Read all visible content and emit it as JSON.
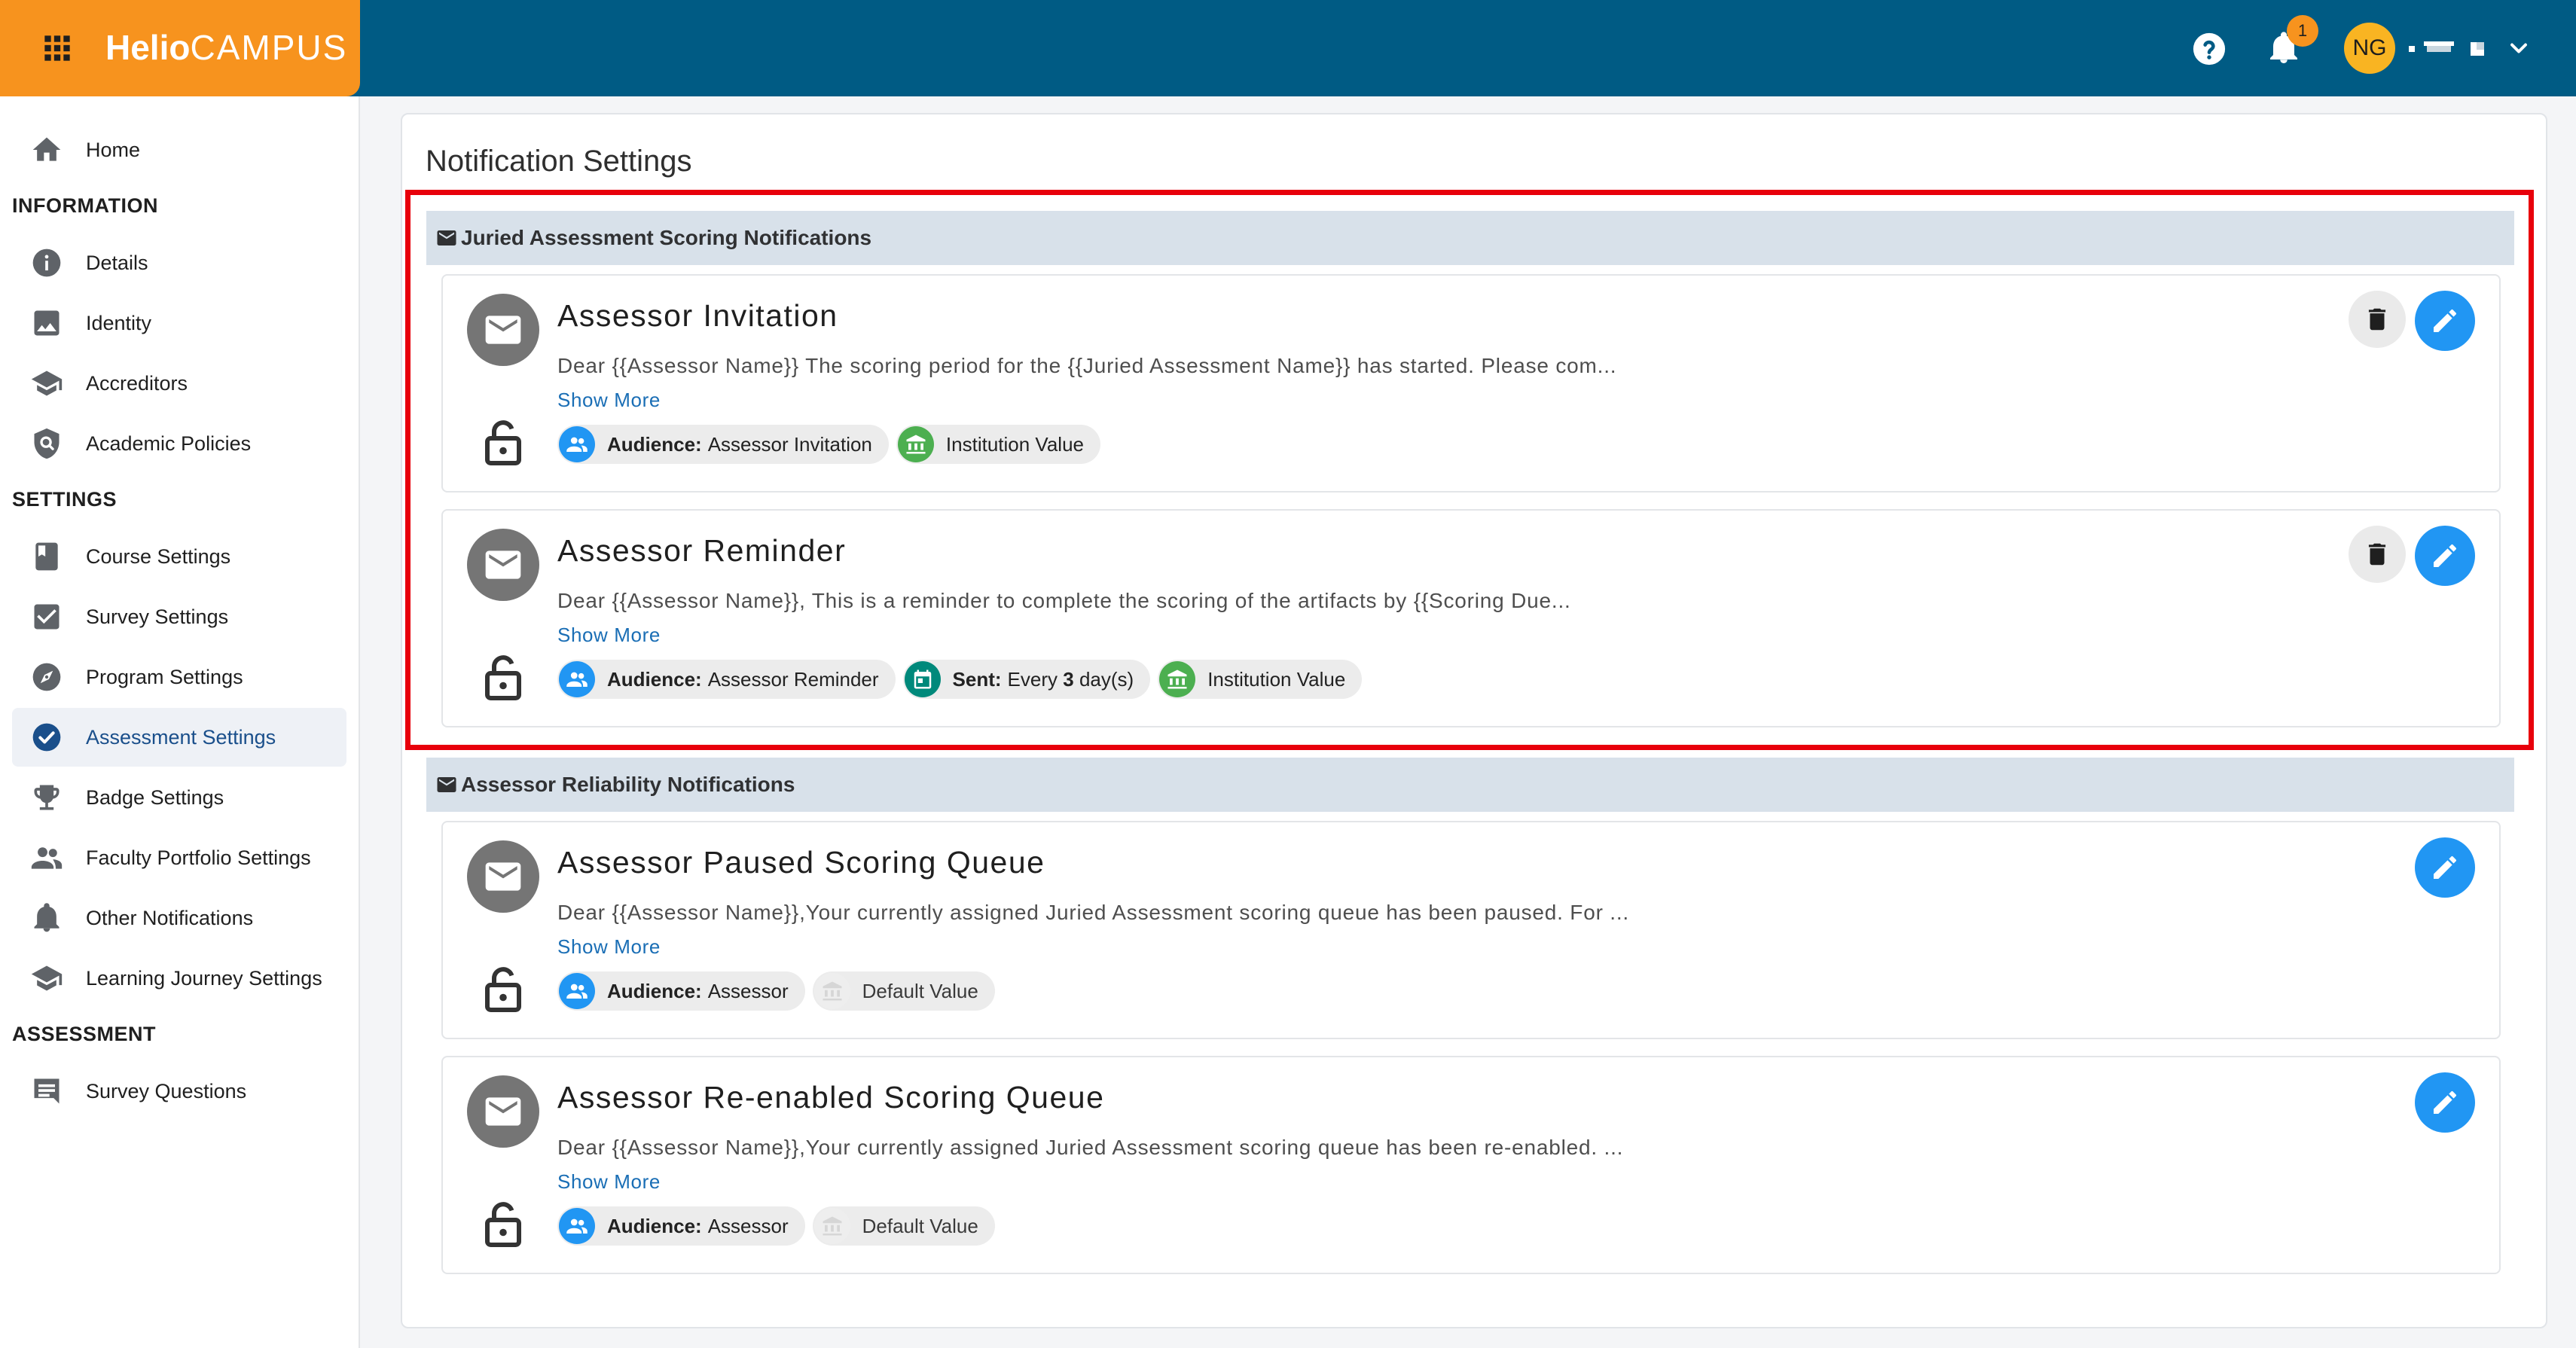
{
  "header": {
    "brand_part1": "Helio",
    "brand_part2": "CAMPUS",
    "notification_count": "1",
    "user_initials": "NG"
  },
  "sidebar": {
    "items": [
      {
        "label": "Home",
        "icon": "home-icon"
      },
      {
        "heading": "INFORMATION"
      },
      {
        "label": "Details",
        "icon": "info-icon"
      },
      {
        "label": "Identity",
        "icon": "image-icon"
      },
      {
        "label": "Accreditors",
        "icon": "school-icon"
      },
      {
        "label": "Academic Policies",
        "icon": "policy-icon"
      },
      {
        "heading": "SETTINGS"
      },
      {
        "label": "Course Settings",
        "icon": "book-icon"
      },
      {
        "label": "Survey Settings",
        "icon": "checkbox-icon"
      },
      {
        "label": "Program Settings",
        "icon": "compass-icon"
      },
      {
        "label": "Assessment Settings",
        "icon": "check-circle-icon",
        "active": true
      },
      {
        "label": "Badge Settings",
        "icon": "trophy-icon"
      },
      {
        "label": "Faculty Portfolio Settings",
        "icon": "people-icon"
      },
      {
        "label": "Other Notifications",
        "icon": "bell-icon"
      },
      {
        "label": "Learning Journey Settings",
        "icon": "school-icon"
      },
      {
        "heading": "ASSESSMENT"
      },
      {
        "label": "Survey Questions",
        "icon": "comment-icon"
      }
    ]
  },
  "main": {
    "title": "Notification Settings",
    "groups": [
      {
        "title": "Juried Assessment Scoring Notifications",
        "cards": [
          {
            "title": "Assessor Invitation",
            "text": "Dear {{Assessor Name}} The scoring period for the {{Juried Assessment Name}} has started. Please com...",
            "show_more": "Show More",
            "audience_label": "Audience:",
            "audience": "Assessor Invitation",
            "value_label": "Institution Value",
            "deletable": true
          },
          {
            "title": "Assessor Reminder",
            "text": "Dear {{Assessor Name}}, This is a reminder to complete the scoring of the artifacts by {{Scoring Due...",
            "show_more": "Show More",
            "audience_label": "Audience:",
            "audience": "Assessor Reminder",
            "sent_label": "Sent:",
            "sent_pre": "Every",
            "sent_num": "3",
            "sent_post": "day(s)",
            "value_label": "Institution Value",
            "deletable": true
          }
        ]
      },
      {
        "title": "Assessor Reliability Notifications",
        "cards": [
          {
            "title": "Assessor Paused Scoring Queue",
            "text": "Dear {{Assessor Name}},Your currently assigned Juried Assessment scoring queue has been paused. For ...",
            "show_more": "Show More",
            "audience_label": "Audience:",
            "audience": "Assessor",
            "value_label": "Default Value",
            "deletable": false
          },
          {
            "title": "Assessor Re-enabled Scoring Queue",
            "text": "Dear {{Assessor Name}},Your currently assigned Juried Assessment scoring queue has been re-enabled. ...",
            "show_more": "Show More",
            "audience_label": "Audience:",
            "audience": "Assessor",
            "value_label": "Default Value",
            "deletable": false
          }
        ]
      }
    ]
  },
  "colors": {
    "topbar": "#005b84",
    "brand": "#f7931e",
    "primary_blue": "#2196f3",
    "highlight_red": "#e8000b",
    "active_nav_text": "#1a4f8b"
  }
}
